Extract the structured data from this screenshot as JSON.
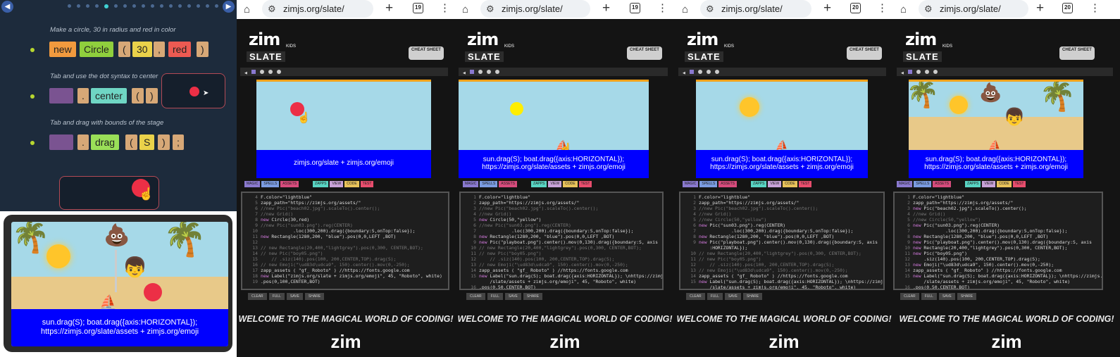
{
  "tutorial": {
    "steps": [
      {
        "instruction": "Make a circle, 30 in radius and red in color",
        "tokens": [
          "new",
          "Circle",
          "(",
          "30",
          ",",
          "red",
          ")"
        ]
      },
      {
        "instruction": "Tab and use the dot syntax to center",
        "tokens": [
          ".",
          "center",
          "(",
          ")"
        ]
      },
      {
        "instruction": "Tab and drag with bounds of the stage",
        "tokens": [
          ".",
          "drag",
          "(",
          "S",
          ")",
          ";"
        ]
      }
    ],
    "tablet_caption_1": "sun.drag(S); boat.drag({axis:HORIZONTAL});",
    "tablet_caption_2": "https://zimjs.org/slate/assets + zimjs.org/emoji"
  },
  "browsers": [
    {
      "url": "zimjs.org/slate/",
      "tab_count": "19",
      "caption_1": "zimjs.org/slate + zimjs.org/emoji",
      "caption_2": "",
      "code": [
        {
          "n": "4",
          "t": "F.color=\"lightblue\"",
          "c": false
        },
        {
          "n": "5",
          "t": "zapp_path=\"https://zimjs.org/assets/\"",
          "c": false
        },
        {
          "n": "6",
          "t": "//new Pic(\"beach02.jpg\").scaleTo().center();",
          "c": true
        },
        {
          "n": "7",
          "t": "//new Grid()",
          "c": true
        },
        {
          "n": "8",
          "t": "new Circle(30,red)",
          "c": false
        },
        {
          "n": "9",
          "t": "//new Pic(\"sun03.png\").reg(CENTER)",
          "c": true
        },
        {
          "n": "10",
          "t": "            .loc(300,200).drag({boundary:S,onTop:false});",
          "c": false
        },
        {
          "n": "11",
          "t": "new Rectangle(1280,200, \"blue\").pos(0,0,LEFT ,BOT)",
          "c": false
        },
        {
          "n": "12",
          "t": "",
          "c": false
        },
        {
          "n": "13",
          "t": "// new Rectangle(20,400,\"lightgrey\").pos(0,300, CENTER,BOT);",
          "c": true
        },
        {
          "n": "14",
          "t": "// new Pic(\"boy05.png\")",
          "c": true
        },
        {
          "n": "15",
          "t": "    // .siz(140).pos(100, 200,CENTER,TOP).drag(S);",
          "c": true
        },
        {
          "n": "16",
          "t": "// new Emoji(\"\\ud83d\\udca9\", 150).center().mov(0,-250);",
          "c": true
        },
        {
          "n": "17",
          "t": "zapp_assets ( \"gf_ Roboto\" ) //https://fonts.google.com",
          "c": false
        },
        {
          "n": "18",
          "t": "new Label(\"zimjs.org/slate + zimjs.org/emoji\", 45, \"Roboto\", white)",
          "c": false
        },
        {
          "n": "19",
          "t": ".pos(0,100,CENTER,BOT)",
          "c": false
        }
      ]
    },
    {
      "url": "zimjs.org/slate/",
      "tab_count": "19",
      "caption_1": "sun.drag(S); boat.drag({axis:HORIZONTAL});",
      "caption_2": "https://zimjs.org/slate/assets + zimjs.org/emoji",
      "code": [
        {
          "n": "1",
          "t": "F.color=\"lightblue\"",
          "c": false
        },
        {
          "n": "2",
          "t": "zapp_path=\"https://zimjs.org/assets/\"",
          "c": false
        },
        {
          "n": "3",
          "t": "//new Pic(\"beach02.jpg\").scaleTo().center();",
          "c": true
        },
        {
          "n": "4",
          "t": "//new Grid()",
          "c": true
        },
        {
          "n": "5",
          "t": "new Circle(50,\"yellow\")",
          "c": false
        },
        {
          "n": "6",
          "t": "//new Pic(\"sun03.png\").reg(CENTER)",
          "c": true
        },
        {
          "n": "7",
          "t": "            .loc(300,200).drag({boundary:S,onTop:false});",
          "c": false
        },
        {
          "n": "8",
          "t": "new Rectangle(1280,200, \"blue\").pos(0,0,LEFT ,BOT)",
          "c": false
        },
        {
          "n": "9",
          "t": "new Pic(\"playboat.png\").center().mov(0,130).drag({boundary:S, axis",
          "c": false
        },
        {
          "n": "10",
          "t": "// new Rectangle(20,400,\"lightgrey\").pos(0,300, CENTER,BOT);",
          "c": true
        },
        {
          "n": "11",
          "t": "// new Pic(\"boy05.png\")",
          "c": true
        },
        {
          "n": "12",
          "t": "    // .siz(140).pos(100, 200,CENTER,TOP).drag(S);",
          "c": true
        },
        {
          "n": "13",
          "t": "// new Emoji(\"\\ud83d\\udca9\", 150).center().mov(0,-250);",
          "c": true
        },
        {
          "n": "14",
          "t": "zapp_assets ( \"gf_ Roboto\" ) //https://fonts.google.com",
          "c": false
        },
        {
          "n": "15",
          "t": "new Label(\"sun.drag(S); boat.drag({axis:HORIZONTAL}); \\nhttps://zimjs.org",
          "c": false
        },
        {
          "n": "",
          "t": "    /slate/assets + zimjs.org/emoji\", 45, \"Roboto\", white)",
          "c": false
        },
        {
          "n": "16",
          "t": ".pos(0,50,CENTER,BOT)",
          "c": false
        }
      ]
    },
    {
      "url": "zimjs.org/slate/",
      "tab_count": "20",
      "caption_1": "sun.drag(S); boat.drag({axis:HORIZONTAL});",
      "caption_2": "https://zimjs.org/slate/assets + zimjs.org/emoji",
      "code": [
        {
          "n": "1",
          "t": "F.color=\"lightblue\"",
          "c": false
        },
        {
          "n": "2",
          "t": "zapp_path=\"https://zimjs.org/assets/\"",
          "c": false
        },
        {
          "n": "3",
          "t": "//new Pic(\"beach02.jpg\").scaleTo().center();",
          "c": true
        },
        {
          "n": "4",
          "t": "//new Grid()",
          "c": true
        },
        {
          "n": "5",
          "t": "//new Circle(50,\"yellow\")",
          "c": true
        },
        {
          "n": "6",
          "t": "new Pic(\"sun03.png\").reg(CENTER)",
          "c": false
        },
        {
          "n": "7",
          "t": "            .loc(300,200).drag({boundary:S,onTop:false});",
          "c": false
        },
        {
          "n": "8",
          "t": "new Rectangle(1280,200, \"blue\").pos(0,0,LEFT ,BOT)",
          "c": false
        },
        {
          "n": "9",
          "t": "new Pic(\"playboat.png\").center().mov(0,130).drag({boundary:S, axis",
          "c": false
        },
        {
          "n": "",
          "t": "    :HORIZONTAL});",
          "c": false
        },
        {
          "n": "10",
          "t": "// new Rectangle(20,400,\"lightgrey\").pos(0,300, CENTER,BOT);",
          "c": true
        },
        {
          "n": "11",
          "t": "// new Pic(\"boy05.png\")",
          "c": true
        },
        {
          "n": "12",
          "t": "    // .siz(140).pos(100, 200,CENTER,TOP).drag(S);",
          "c": true
        },
        {
          "n": "13",
          "t": "// new Emoji(\"\\ud83d\\udca9\", 150).center().mov(0,-250);",
          "c": true
        },
        {
          "n": "14",
          "t": "zapp_assets ( \"gf_ Roboto\" ) //https://fonts.google.com",
          "c": false
        },
        {
          "n": "15",
          "t": "new Label(\"sun.drag(S); boat.drag({axis:HORIZONTAL}); \\nhttps://zimjs.org",
          "c": false
        },
        {
          "n": "",
          "t": "    /slate/assets + zimjs.org/emoji\", 45, \"Roboto\", white)",
          "c": false
        },
        {
          "n": "16",
          "t": ".pos(0,50,CENTER,BOT)",
          "c": false
        }
      ]
    },
    {
      "url": "zimjs.org/slate/",
      "tab_count": "20",
      "caption_1": "sun.drag(S); boat.drag({axis:HORIZONTAL});",
      "caption_2": "https://zimjs.org/slate/assets + zimjs.org/emoji",
      "code": [
        {
          "n": "1",
          "t": "F.color=\"lightblue\"",
          "c": false
        },
        {
          "n": "2",
          "t": "zapp_path=\"https://zimjs.org/assets/\"",
          "c": false
        },
        {
          "n": "3",
          "t": "new Pic(\"beach02.jpg\").scaleTo().center();",
          "c": false
        },
        {
          "n": "4",
          "t": "//new Grid()",
          "c": true
        },
        {
          "n": "5",
          "t": "//new Circle(50,\"yellow\")",
          "c": true
        },
        {
          "n": "6",
          "t": "new Pic(\"sun03.png\").reg(CENTER)",
          "c": false
        },
        {
          "n": "7",
          "t": "            .loc(300,200).drag({boundary:S,onTop:false});",
          "c": false
        },
        {
          "n": "8",
          "t": "new Rectangle(1280,200, \"blue\").pos(0,0,LEFT ,BOT)",
          "c": false
        },
        {
          "n": "9",
          "t": "new Pic(\"playboat.png\").center().mov(0,130).drag({boundary:S, axis",
          "c": false
        },
        {
          "n": "10",
          "t": "new Rectangle(20,400,\"lightgrey\").pos(0,300, CENTER,BOT);",
          "c": false
        },
        {
          "n": "11",
          "t": "new Pic(\"boy05.png\")",
          "c": false
        },
        {
          "n": "12",
          "t": "    .siz(140).pos(100, 200,CENTER,TOP).drag(S);",
          "c": false
        },
        {
          "n": "13",
          "t": "new Emoji(\"\\ud83d\\udca9\", 150).center().mov(0,-250);",
          "c": false
        },
        {
          "n": "14",
          "t": "zapp_assets ( \"gf_ Roboto\" ) //https://fonts.google.com",
          "c": false
        },
        {
          "n": "15",
          "t": "new Label(\"sun.drag(S); boat.drag({axis:HORIZONTAL}); \\nhttps://zimjs.org",
          "c": false
        },
        {
          "n": "",
          "t": "    /slate/assets + zimjs.org/emoji\", 45, \"Roboto\", white)",
          "c": false
        },
        {
          "n": "16",
          "t": ".pos(0,50,CENTER,BOT)",
          "c": false
        }
      ]
    }
  ],
  "common": {
    "logo": "zim",
    "kids": "KIDS",
    "slate": "SLATE",
    "cheat_sheet": "CHEAT SHEET",
    "tabs": [
      "MAGIC",
      "SPELLS",
      "ASSETS",
      "ZAPPS",
      "VIEW",
      "CODE",
      "TEST"
    ],
    "buttons": [
      "CLEAR",
      "FULL",
      "SAVE",
      "SHARE"
    ],
    "welcome": "WELCOME TO THE MAGICAL WORLD OF CODING!"
  },
  "colors": {
    "stage_sky": "#a6d9e8",
    "water": "#0000ff",
    "accent": "#f4a21a"
  }
}
